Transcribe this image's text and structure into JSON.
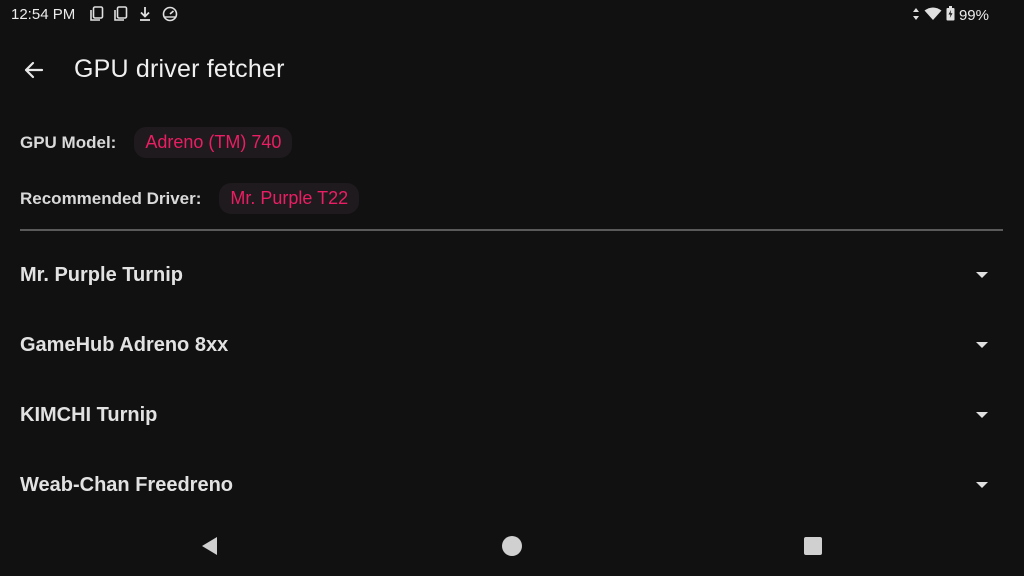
{
  "status_bar": {
    "time": "12:54 PM",
    "battery": "99%",
    "left_icons": [
      "copy-icon",
      "copy-icon",
      "download-icon",
      "speedometer-icon"
    ],
    "right_icons": [
      "data-arrows-icon",
      "wifi-icon",
      "battery-icon"
    ]
  },
  "app_bar": {
    "title": "GPU driver fetcher",
    "back_icon": "back-arrow-icon"
  },
  "info": {
    "gpu_model_label": "GPU Model:",
    "gpu_model_value": "Adreno (TM) 740",
    "recommended_label": "Recommended Driver:",
    "recommended_value": "Mr. Purple T22"
  },
  "drivers": [
    {
      "name": "Mr. Purple Turnip"
    },
    {
      "name": "GameHub Adreno 8xx"
    },
    {
      "name": "KIMCHI Turnip"
    },
    {
      "name": "Weab-Chan Freedreno"
    }
  ],
  "nav_bar": {
    "icons": [
      "back-triangle-icon",
      "home-circle-icon",
      "recents-square-icon"
    ]
  },
  "colors": {
    "background": "#111111",
    "accent": "#e91e63",
    "chip_bg": "#1f1a1d",
    "divider": "#5a5a5a"
  }
}
